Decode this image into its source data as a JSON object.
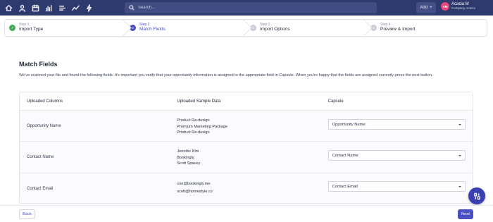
{
  "nav": {
    "icons": [
      "home-icon",
      "person-icon",
      "calendar-icon",
      "bar-chart-icon",
      "list-icon",
      "trend-icon",
      "lightning-icon"
    ],
    "search_placeholder": "Search...",
    "add_label": "Add",
    "add_icon": "plus-icon",
    "user": {
      "initials": "AM",
      "name": "Acacia M",
      "company": "Company Acacia"
    },
    "colors": {
      "bar": "#2e3a6e",
      "avatar": "#e8457a"
    }
  },
  "stepper": {
    "steps": [
      {
        "num": "Step 1",
        "title": "Import Type",
        "state": "done",
        "marker": "✓"
      },
      {
        "num": "Step 2",
        "title": "Match Fields",
        "state": "current",
        "marker": "2"
      },
      {
        "num": "Step 3",
        "title": "Import Options",
        "state": "todo",
        "marker": "3"
      },
      {
        "num": "Step 4",
        "title": "Preview & Import",
        "state": "todo",
        "marker": "4"
      }
    ]
  },
  "main": {
    "title": "Match Fields",
    "description": "We've scanned your file and found the following fields. It's important you verify that your opportunity information is assigned to the appropriate field in Capsule. When you're happy that the fields are assigned correctly press the next button.",
    "table": {
      "headers": [
        "Uploaded Columns",
        "Uploaded Sample Data",
        "Capsule"
      ],
      "rows": [
        {
          "column": "Opportunity Name",
          "samples": [
            "Product Re-design",
            "Premium Marketing Package",
            "Product Re-design"
          ],
          "capsule": "Opportunity Name"
        },
        {
          "column": "Contact Name",
          "samples": [
            "Jennifer Kim",
            "Bookingly",
            "Scott Spacey"
          ],
          "capsule": "Contact Name"
        },
        {
          "column": "Contact Email",
          "samples": [
            "coo@bookingly.me",
            "scott@homestyle.co"
          ],
          "capsule": "Contact Email"
        }
      ]
    }
  },
  "footer": {
    "back_label": "Back",
    "next_label": "Next"
  },
  "accent": "#4a4fc4"
}
